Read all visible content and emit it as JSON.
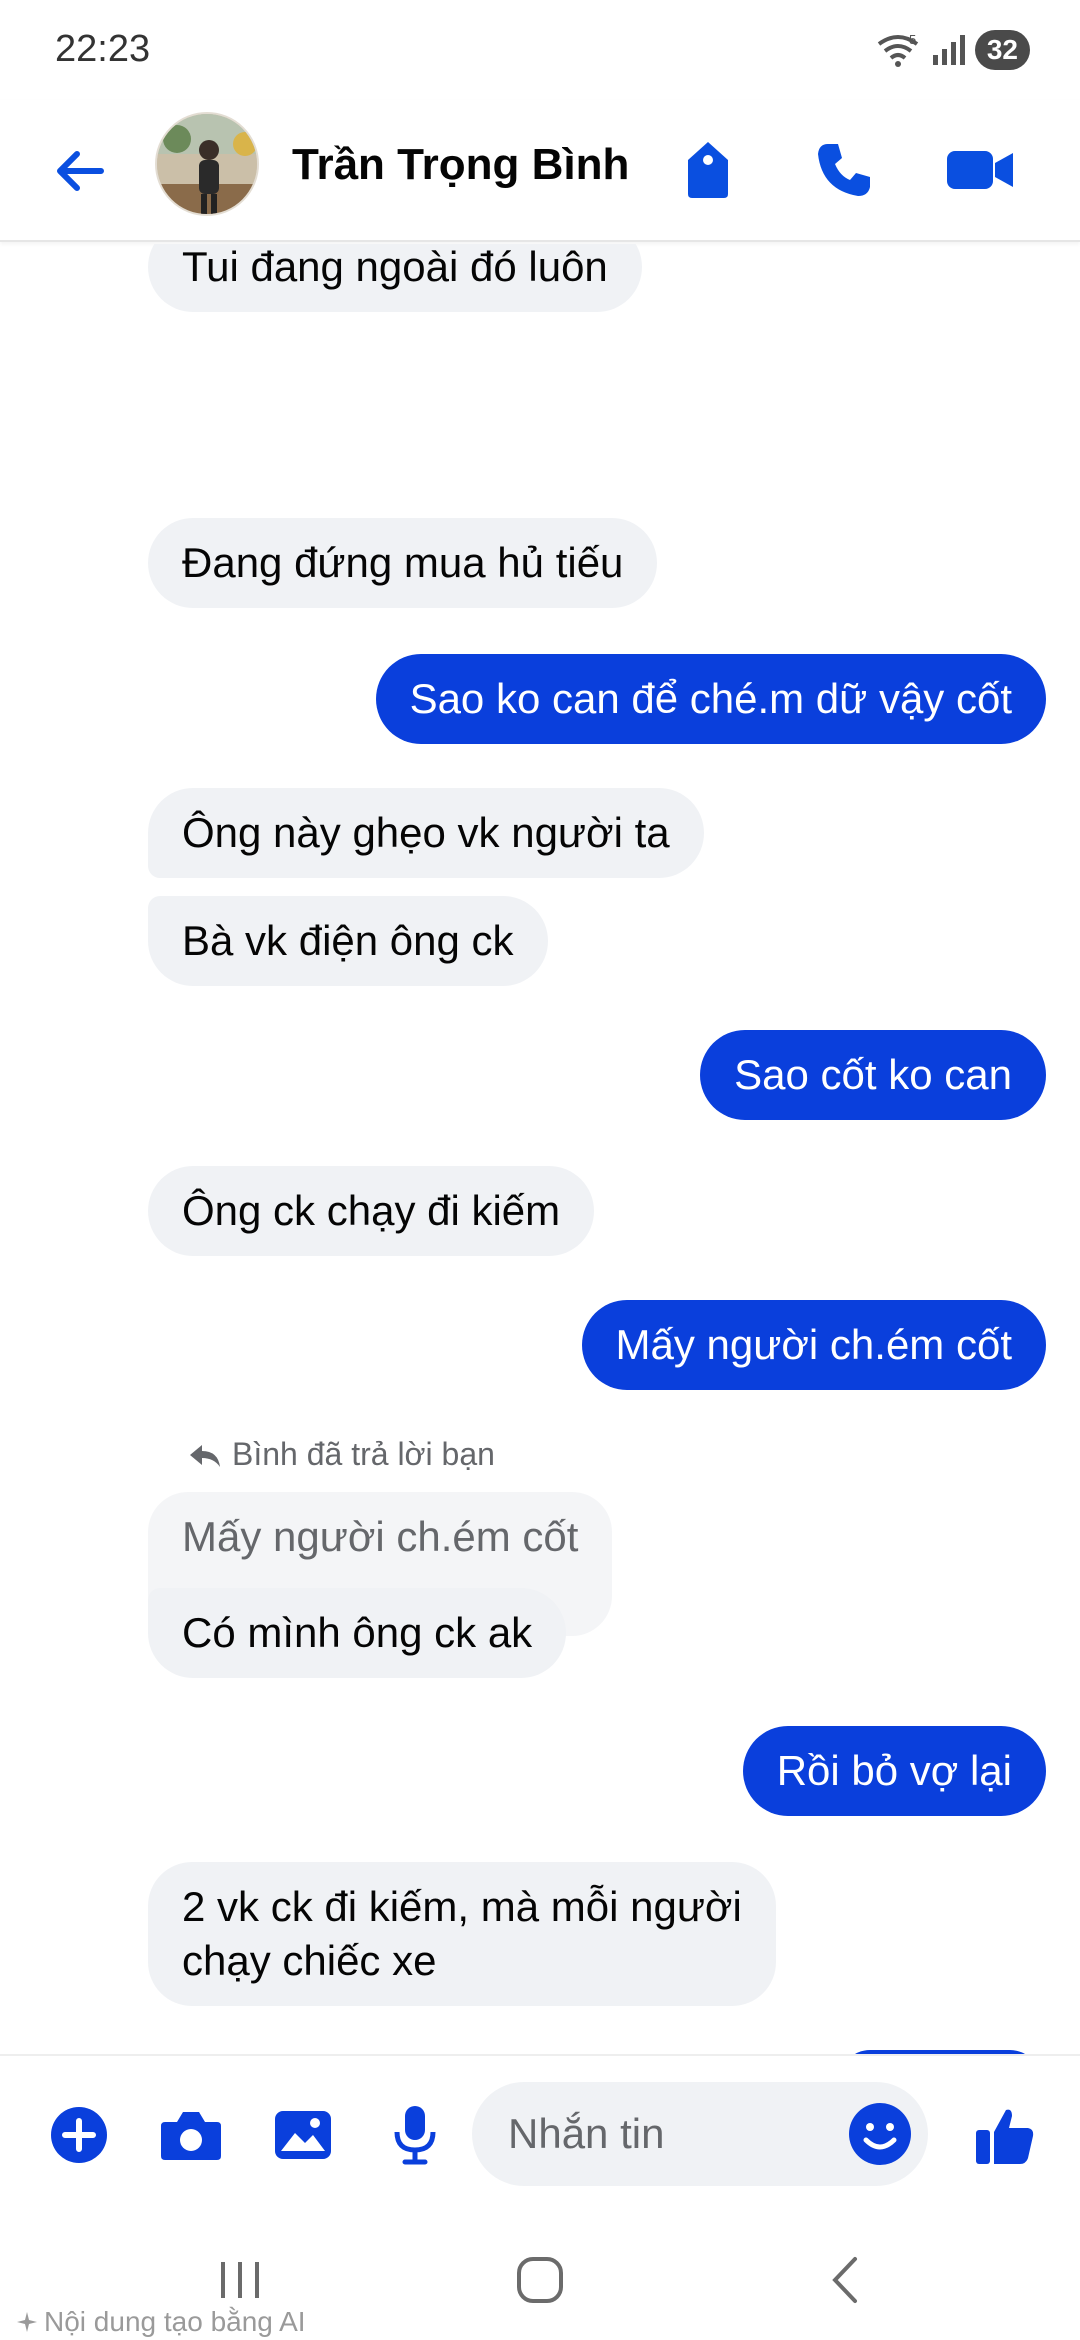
{
  "status_bar": {
    "time": "22:23",
    "network_badge": "5",
    "battery": "32"
  },
  "header": {
    "contact_name": "Trần Trọng Bình",
    "icons": [
      "back-arrow-icon",
      "tag-icon",
      "phone-icon",
      "video-call-icon"
    ]
  },
  "messages": {
    "m1": "Tui đang ngoài đó luôn",
    "m2": "Đang đứng mua hủ tiếu",
    "m3": "Sao ko can để ché.m dữ vậy cốt",
    "m4": "Ông này ghẹo vk người ta",
    "m5": "Bà vk điện ông ck",
    "m6": "Sao cốt ko can",
    "m7": "Ông ck chạy đi kiếm",
    "m8": "Mấy người ch.ém cốt",
    "reply_label": "Bình đã trả lời bạn",
    "quoted": "Mấy người ch.ém cốt",
    "m9": "Có mình ông ck ak",
    "m10": "Rồi bỏ vợ lại",
    "m11_line1": "2 vk ck đi kiếm, mà mỗi người",
    "m11_line2": "chạy chiếc xe"
  },
  "composer": {
    "placeholder": "Nhắn tin"
  },
  "footer": {
    "ai_note": "Nội dung tạo bằng AI"
  },
  "colors": {
    "accent": "#0a3fdc",
    "icon_blue": "#0a4fe0",
    "incoming_bg": "#f0f2f5"
  }
}
